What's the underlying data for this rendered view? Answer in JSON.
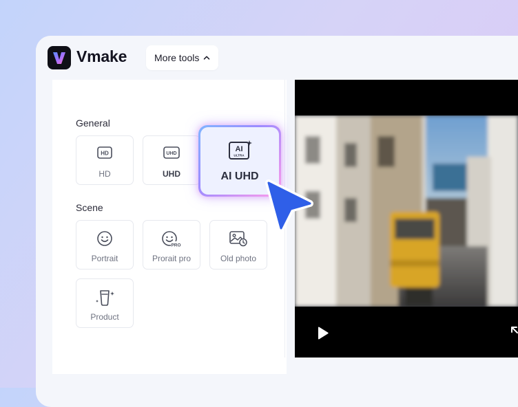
{
  "brand": {
    "name": "Vmake"
  },
  "header": {
    "more_tools_label": "More tools"
  },
  "sections": {
    "general": {
      "title": "General",
      "items": [
        {
          "label": "HD",
          "icon": "hd-icon"
        },
        {
          "label": "UHD",
          "icon": "uhd-icon"
        },
        {
          "label": "AI UHD",
          "icon": "ai-ultra-icon",
          "badge": "ULTRA",
          "badge_text": "AI",
          "selected": true
        }
      ]
    },
    "scene": {
      "title": "Scene",
      "items": [
        {
          "label": "Portrait",
          "icon": "smile-face-icon"
        },
        {
          "label": "Prorait pro",
          "icon": "smile-face-pro-icon",
          "badge": "PRO"
        },
        {
          "label": "Old photo",
          "icon": "old-photo-icon"
        },
        {
          "label": "Product",
          "icon": "product-icon"
        }
      ]
    }
  },
  "colors": {
    "accent": "#2f5fe8",
    "cursor": "#2f5fe8",
    "selected_glow_start": "#7fb6ff",
    "selected_glow_end": "#ff9bea"
  }
}
